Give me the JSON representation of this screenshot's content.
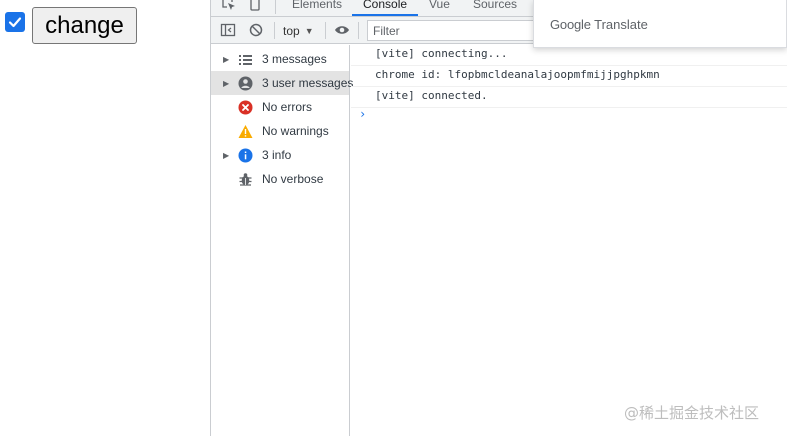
{
  "page": {
    "checkbox_checked": true,
    "button_label": "change"
  },
  "devtools": {
    "tabs": [
      {
        "label": "Elements",
        "active": false
      },
      {
        "label": "Console",
        "active": true
      },
      {
        "label": "Vue",
        "active": false
      },
      {
        "label": "Sources",
        "active": false
      }
    ],
    "toolbar": {
      "context": "top",
      "filter_placeholder": "Filter"
    },
    "sidebar": [
      {
        "label": "3 messages",
        "icon": "list-icon",
        "expandable": true,
        "selected": false
      },
      {
        "label": "3 user messages",
        "icon": "user-icon",
        "expandable": true,
        "selected": true
      },
      {
        "label": "No errors",
        "icon": "error-icon",
        "expandable": false,
        "selected": false
      },
      {
        "label": "No warnings",
        "icon": "warning-icon",
        "expandable": false,
        "selected": false
      },
      {
        "label": "3 info",
        "icon": "info-icon",
        "expandable": true,
        "selected": false
      },
      {
        "label": "No verbose",
        "icon": "bug-icon",
        "expandable": false,
        "selected": false
      }
    ],
    "console_messages": [
      "[vite] connecting...",
      "chrome id: lfopbmcldeanalajoopmfmijjpghpkmn",
      "[vite] connected."
    ],
    "prompt_symbol": "›"
  },
  "translate_popup": {
    "brand": "Google",
    "product": "Translate"
  },
  "watermark": "@稀土掘金技术社区",
  "colors": {
    "accent": "#1a73e8",
    "error": "#d93025",
    "warning": "#f9ab00",
    "info": "#1a73e8"
  }
}
